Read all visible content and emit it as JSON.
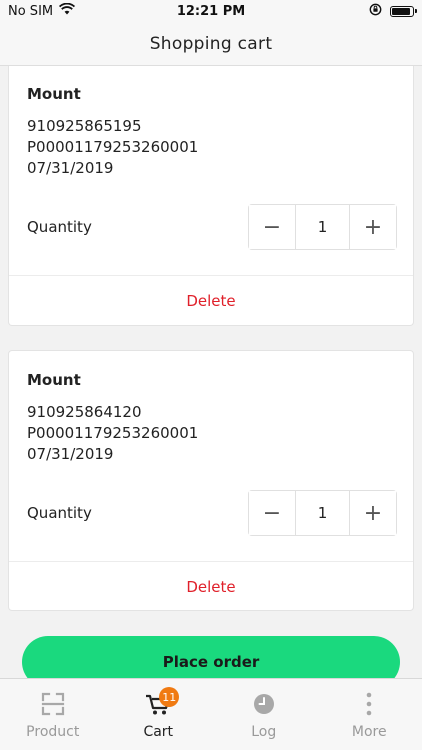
{
  "status_bar": {
    "carrier": "No SIM",
    "time": "12:21 PM"
  },
  "nav": {
    "title": "Shopping cart"
  },
  "cart_items": [
    {
      "name": "Mount",
      "code": "910925865195",
      "serial": "P00001179253260001",
      "date": "07/31/2019",
      "quantity_label": "Quantity",
      "quantity": "1",
      "delete_label": "Delete"
    },
    {
      "name": "Mount",
      "code": "910925864120",
      "serial": "P00001179253260001",
      "date": "07/31/2019",
      "quantity_label": "Quantity",
      "quantity": "1",
      "delete_label": "Delete"
    }
  ],
  "stepper": {
    "minus": "−",
    "plus": "+"
  },
  "place_order_label": "Place order",
  "tabs": [
    {
      "label": "Product",
      "icon": "scan-icon"
    },
    {
      "label": "Cart",
      "icon": "cart-icon",
      "badge": "11"
    },
    {
      "label": "Log",
      "icon": "clock-icon"
    },
    {
      "label": "More",
      "icon": "more-vertical-icon"
    }
  ],
  "colors": {
    "accent_green": "#1ad97e",
    "delete_red": "#e0202a",
    "badge_orange": "#f07a12"
  }
}
